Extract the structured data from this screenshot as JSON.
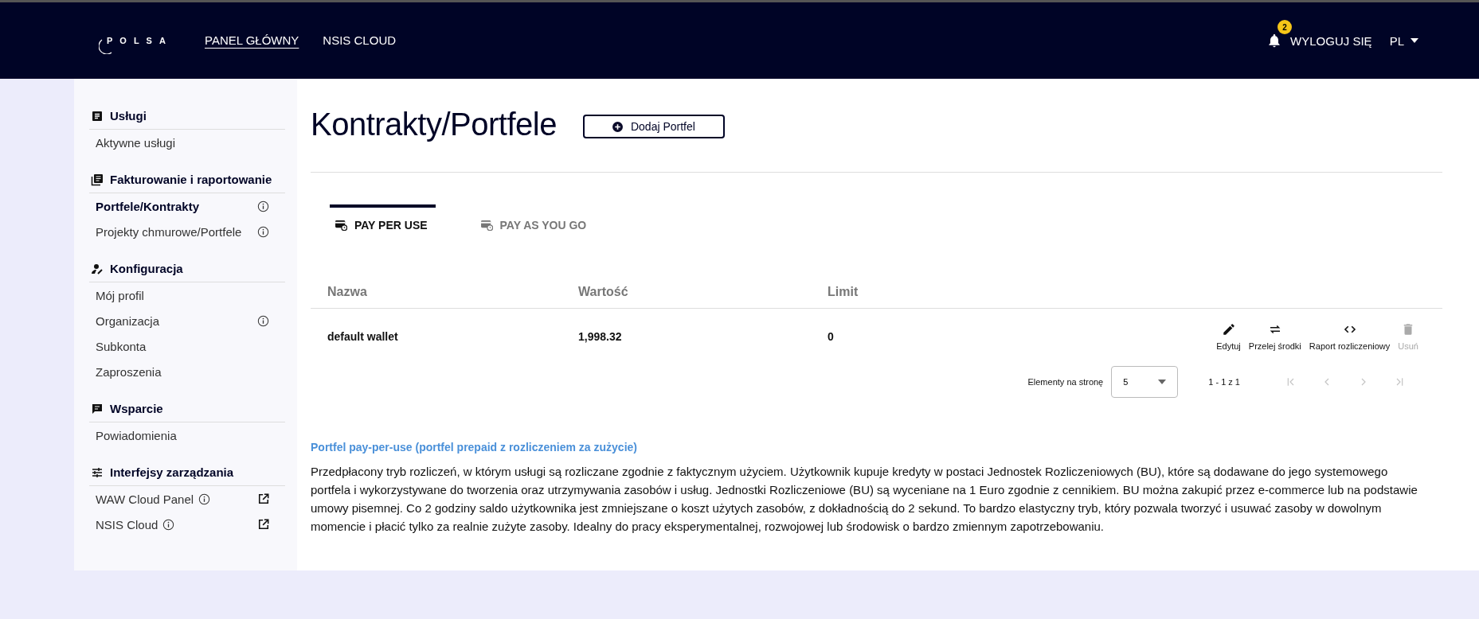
{
  "header": {
    "logo": "POLSA",
    "nav": [
      {
        "label": "PANEL GŁÓWNY",
        "selected": true
      },
      {
        "label": "NSIS CLOUD",
        "selected": false
      }
    ],
    "notifications": "2",
    "logout": "WYLOGUJ SIĘ",
    "language": "PL"
  },
  "sidebar": {
    "sections": [
      {
        "title": "Usługi",
        "items": [
          {
            "label": "Aktywne usługi",
            "selected": false,
            "info": false,
            "external": false
          }
        ]
      },
      {
        "title": "Fakturowanie i raportowanie",
        "items": [
          {
            "label": "Portfele/Kontrakty",
            "selected": true,
            "info": true,
            "external": false
          },
          {
            "label": "Projekty chmurowe/Portfele",
            "selected": false,
            "info": true,
            "external": false
          }
        ]
      },
      {
        "title": "Konfiguracja",
        "items": [
          {
            "label": "Mój profil",
            "selected": false,
            "info": false,
            "external": false
          },
          {
            "label": "Organizacja",
            "selected": false,
            "info": true,
            "external": false
          },
          {
            "label": "Subkonta",
            "selected": false,
            "info": false,
            "external": false
          },
          {
            "label": "Zaproszenia",
            "selected": false,
            "info": false,
            "external": false
          }
        ]
      },
      {
        "title": "Wsparcie",
        "items": [
          {
            "label": "Powiadomienia",
            "selected": false,
            "info": false,
            "external": false
          }
        ]
      },
      {
        "title": "Interfejsy zarządzania",
        "items": [
          {
            "label": "WAW Cloud Panel",
            "selected": false,
            "info": true,
            "external": true
          },
          {
            "label": "NSIS Cloud",
            "selected": false,
            "info": true,
            "external": true
          }
        ]
      }
    ]
  },
  "page": {
    "title": "Kontrakty/Portfele",
    "add_button": "Dodaj Portfel"
  },
  "tabs": [
    {
      "label": "PAY PER USE",
      "selected": true
    },
    {
      "label": "PAY AS YOU GO",
      "selected": false
    }
  ],
  "table": {
    "columns": [
      "Nazwa",
      "Wartość",
      "Limit"
    ],
    "rows": [
      {
        "name": "default wallet",
        "value": "1,998.32",
        "limit": "0",
        "actions": [
          {
            "label": "Edytuj",
            "disabled": false
          },
          {
            "label": "Przelej środki",
            "disabled": false
          },
          {
            "label": "Raport rozliczeniowy",
            "disabled": false
          },
          {
            "label": "Usuń",
            "disabled": true
          }
        ]
      }
    ]
  },
  "pagination": {
    "label": "Elementy na stronę",
    "page_size": "5",
    "range": "1 - 1 z 1",
    "buttons": [
      {
        "disabled": true
      },
      {
        "disabled": true
      },
      {
        "disabled": true
      },
      {
        "disabled": true
      }
    ]
  },
  "description": {
    "title": "Portfel pay-per-use (portfel prepaid z rozliczeniem za zużycie)",
    "text": "Przedpłacony tryb rozliczeń, w którym usługi są rozliczane zgodnie z faktycznym użyciem. Użytkownik kupuje kredyty w postaci Jednostek Rozliczeniowych (BU), które są dodawane do jego systemowego portfela i wykorzystywane do tworzenia oraz utrzymywania zasobów i usług. Jednostki Rozliczeniowe (BU) są wyceniane na 1 Euro zgodnie z cennikiem. BU można zakupić przez e-commerce lub na podstawie umowy pisemnej. Co 2 godziny saldo użytkownika jest zmniejszane o koszt użytych zasobów, z dokładnością do 2 sekund. To bardzo elastyczny tryb, który pozwala tworzyć i usuwać zasoby w dowolnym momencie i płacić tylko za realnie zużyte zasoby. Idealny do pracy eksperymentalnej, rozwojowej lub środowisk o bardzo zmiennym zapotrzebowaniu."
  }
}
